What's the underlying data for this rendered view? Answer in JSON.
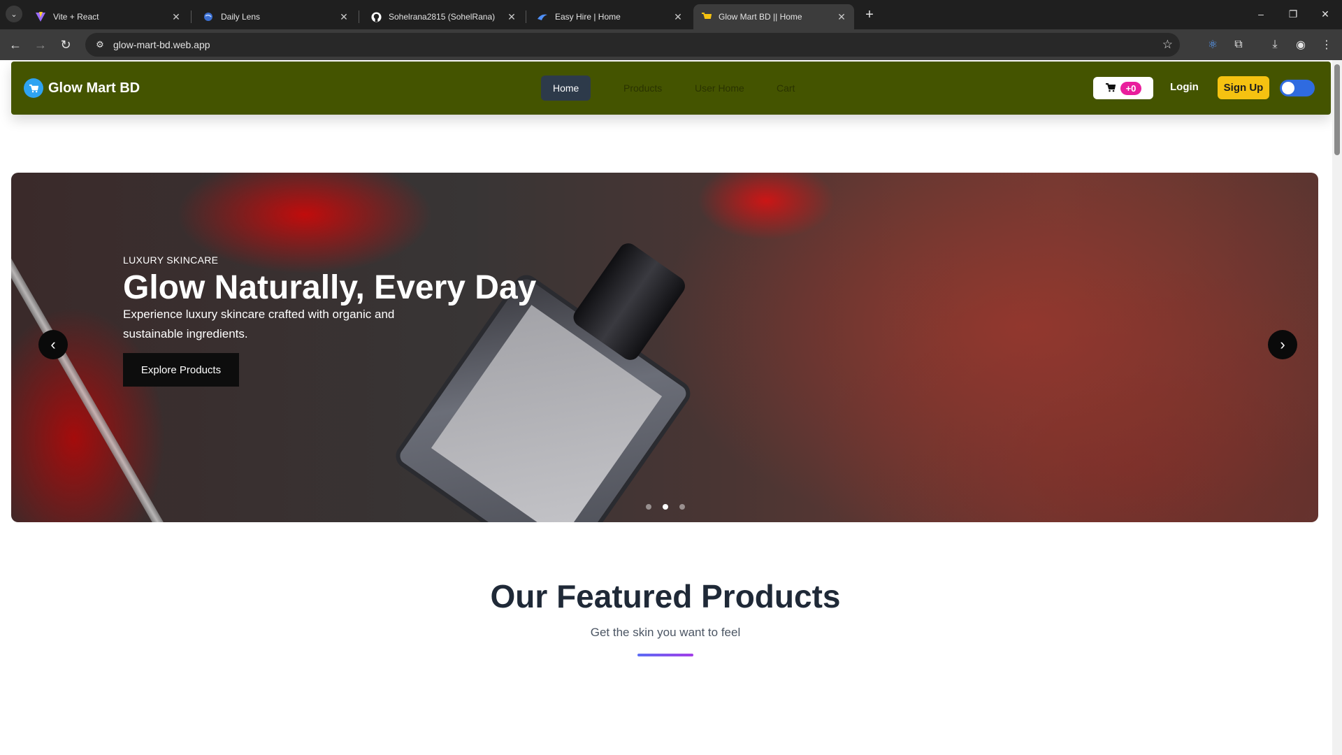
{
  "browser": {
    "tabs": [
      {
        "title": "Vite + React",
        "icon": "vite-icon"
      },
      {
        "title": "Daily Lens",
        "icon": "globe-icon"
      },
      {
        "title": "Sohelrana2815 (SohelRana)",
        "icon": "github-icon"
      },
      {
        "title": "Easy Hire | Home",
        "icon": "bird-icon"
      },
      {
        "title": "Glow Mart BD || Home",
        "icon": "cart-icon",
        "active": true
      }
    ],
    "url": "glow-mart-bd.web.app"
  },
  "navbar": {
    "brand": "Glow Mart BD",
    "links": [
      {
        "label": "Home",
        "active": true
      },
      {
        "label": "Products"
      },
      {
        "label": "User Home"
      },
      {
        "label": "Cart"
      }
    ],
    "cart_count": "+0",
    "login": "Login",
    "signup": "Sign Up",
    "theme_toggle_on": true,
    "colors": {
      "bar": "#445400",
      "signup": "#f5c211",
      "badge": "#e91e9c",
      "toggle": "#2f6be0"
    }
  },
  "hero": {
    "kicker": "LUXURY SKINCARE",
    "title": "Glow Naturally, Every Day",
    "text": "Experience luxury skincare crafted with organic and sustainable ingredients.",
    "cta": "Explore Products",
    "prev_icon": "chevron-left-icon",
    "next_icon": "chevron-right-icon",
    "slide_count": 3,
    "active_slide": 2
  },
  "featured": {
    "title": "Our Featured Products",
    "subtitle": "Get the skin you want to feel"
  }
}
